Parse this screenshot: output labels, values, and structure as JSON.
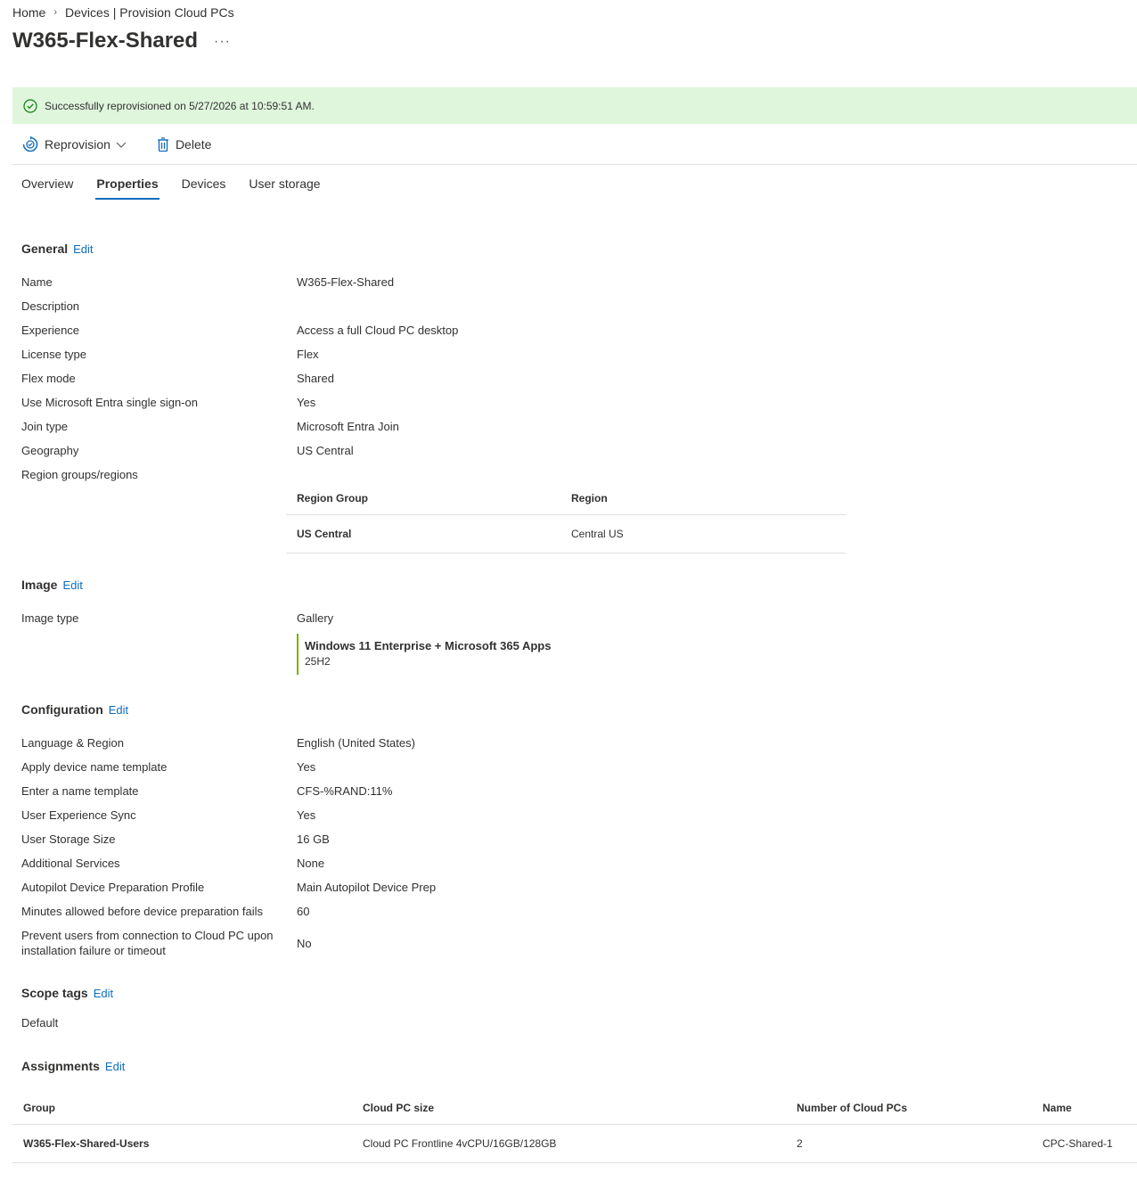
{
  "breadcrumb": [
    "Home",
    "Devices | Provision Cloud PCs"
  ],
  "title": "W365-Flex-Shared",
  "more_label": "···",
  "banner": {
    "message": "Successfully reprovisioned on 5/27/2026 at 10:59:51 AM.",
    "color": "#dff6dd",
    "icon": "success-check-icon"
  },
  "toolbar": {
    "reprovision": "Reprovision",
    "delete": "Delete"
  },
  "tabs": [
    "Overview",
    "Properties",
    "Devices",
    "User storage"
  ],
  "active_tab": "Properties",
  "edit_label": "Edit",
  "general": {
    "heading": "General",
    "rows": [
      {
        "label": "Name",
        "value": "W365-Flex-Shared"
      },
      {
        "label": "Description",
        "value": ""
      },
      {
        "label": "Experience",
        "value": "Access a full Cloud PC desktop"
      },
      {
        "label": "License type",
        "value": "Flex"
      },
      {
        "label": "Flex mode",
        "value": "Shared"
      },
      {
        "label": "Use Microsoft Entra single sign-on",
        "value": "Yes"
      },
      {
        "label": "Join type",
        "value": "Microsoft Entra Join"
      },
      {
        "label": "Geography",
        "value": "US Central"
      },
      {
        "label": "Region groups/regions",
        "value": ""
      }
    ],
    "region_table": {
      "headers": [
        "Region Group",
        "Region"
      ],
      "rows": [
        [
          "US Central",
          "Central US"
        ]
      ]
    }
  },
  "image": {
    "heading": "Image",
    "label": "Image type",
    "value": "Gallery",
    "card_name": "Windows 11 Enterprise + Microsoft 365 Apps",
    "card_version": "25H2"
  },
  "configuration": {
    "heading": "Configuration",
    "rows": [
      {
        "label": "Language & Region",
        "value": "English (United States)"
      },
      {
        "label": "Apply device name template",
        "value": "Yes"
      },
      {
        "label": "Enter a name template",
        "value": "CFS-%RAND:11%"
      },
      {
        "label": "User Experience Sync",
        "value": "Yes"
      },
      {
        "label": "User Storage Size",
        "value": "16 GB"
      },
      {
        "label": "Additional Services",
        "value": "None"
      },
      {
        "label": "Autopilot Device Preparation Profile",
        "value": "Main Autopilot Device Prep"
      },
      {
        "label": "Minutes allowed before device preparation fails",
        "value": "60"
      }
    ],
    "prevent_label_1": "Prevent users from connection to Cloud PC upon",
    "prevent_label_2": "installation failure or timeout",
    "prevent_value": "No"
  },
  "scope_tags": {
    "heading": "Scope tags",
    "value": "Default"
  },
  "assignments": {
    "heading": "Assignments",
    "headers": [
      "Group",
      "Cloud PC size",
      "Number of Cloud PCs",
      "Name"
    ],
    "rows": [
      [
        "W365-Flex-Shared-Users",
        "Cloud PC Frontline 4vCPU/16GB/128GB",
        "2",
        "CPC-Shared-1"
      ]
    ]
  },
  "colors": {
    "accent": "#0f6cbd",
    "success": "#107c10",
    "image_bar": "#6bb700"
  }
}
